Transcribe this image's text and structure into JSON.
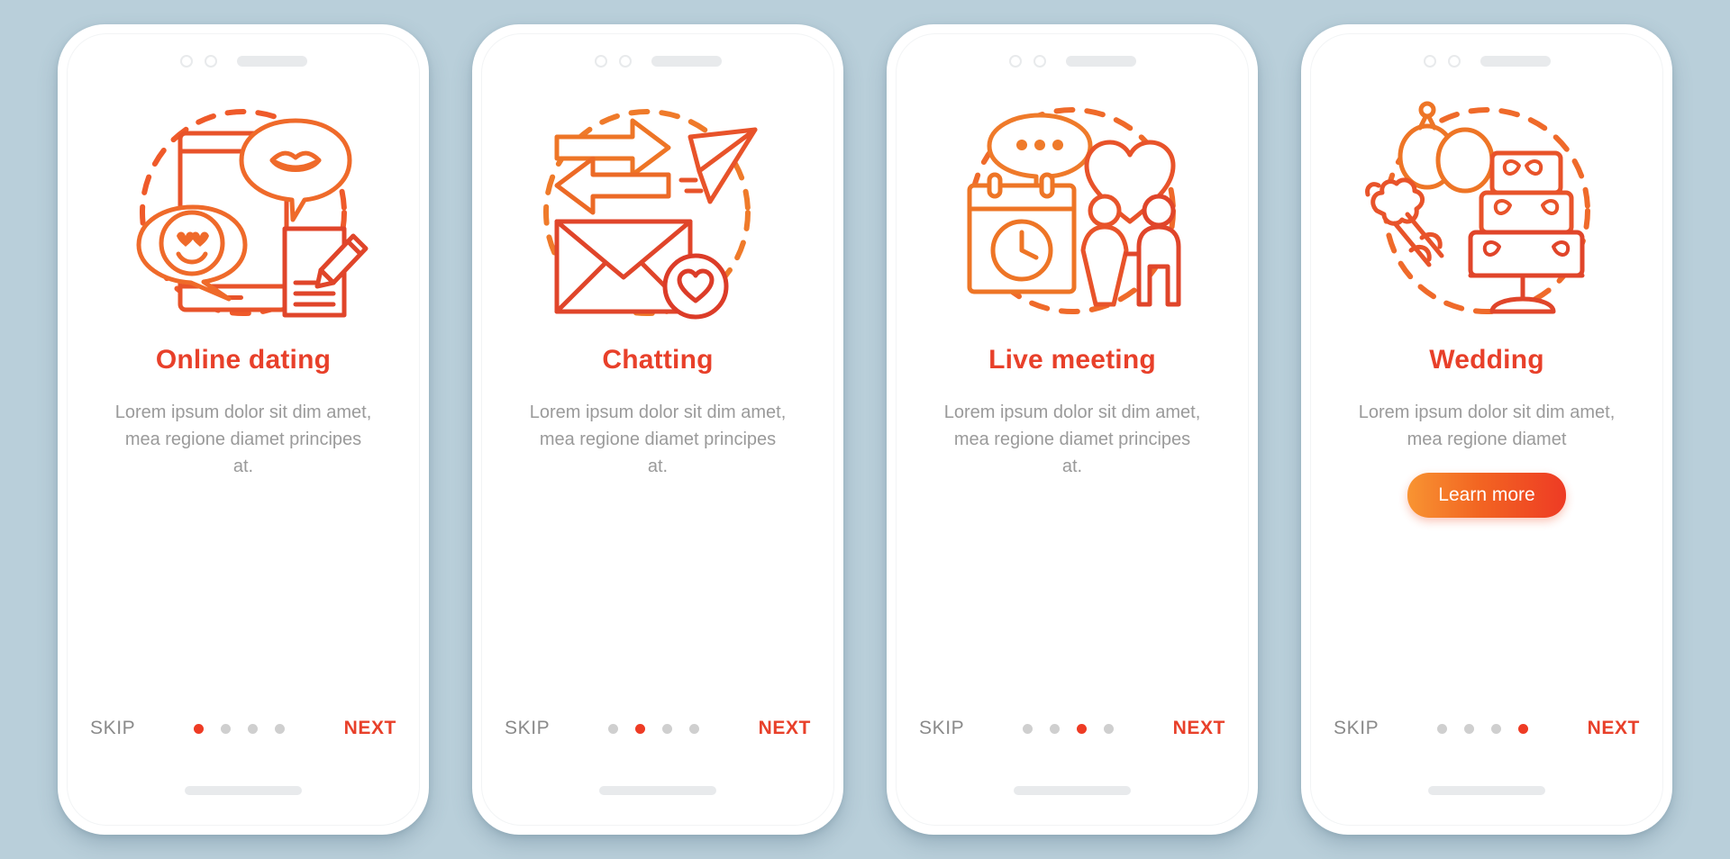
{
  "theme": {
    "background": "#b9cfda",
    "accent": "#e8402a",
    "accent_orange": "#f89432",
    "muted_text": "#9a9a9a",
    "skip_text": "#8a8a8a",
    "dot_inactive": "#cfcfcf"
  },
  "screens": [
    {
      "id": "online-dating",
      "title": "Online dating",
      "body": "Lorem ipsum dolor sit dim amet, mea regione diamet principes at.",
      "icon": "phone-chat-bubbles-lips-pencil-icon",
      "cta": null,
      "skip_label": "SKIP",
      "next_label": "NEXT",
      "dots": 4,
      "active_dot": 0
    },
    {
      "id": "chatting",
      "title": "Chatting",
      "body": "Lorem ipsum dolor sit dim amet, mea regione diamet principes at.",
      "icon": "arrows-envelope-paperplane-heart-icon",
      "cta": null,
      "skip_label": "SKIP",
      "next_label": "NEXT",
      "dots": 4,
      "active_dot": 1
    },
    {
      "id": "live-meeting",
      "title": "Live meeting",
      "body": "Lorem ipsum dolor sit dim amet, mea regione diamet principes at.",
      "icon": "calendar-couple-heart-speechbubble-icon",
      "cta": null,
      "skip_label": "SKIP",
      "next_label": "NEXT",
      "dots": 4,
      "active_dot": 2
    },
    {
      "id": "wedding",
      "title": "Wedding",
      "body": "Lorem ipsum dolor sit dim amet, mea regione diamet",
      "icon": "rings-bouquet-wedding-cake-icon",
      "cta": "Learn more",
      "skip_label": "SKIP",
      "next_label": "NEXT",
      "dots": 4,
      "active_dot": 3
    }
  ]
}
